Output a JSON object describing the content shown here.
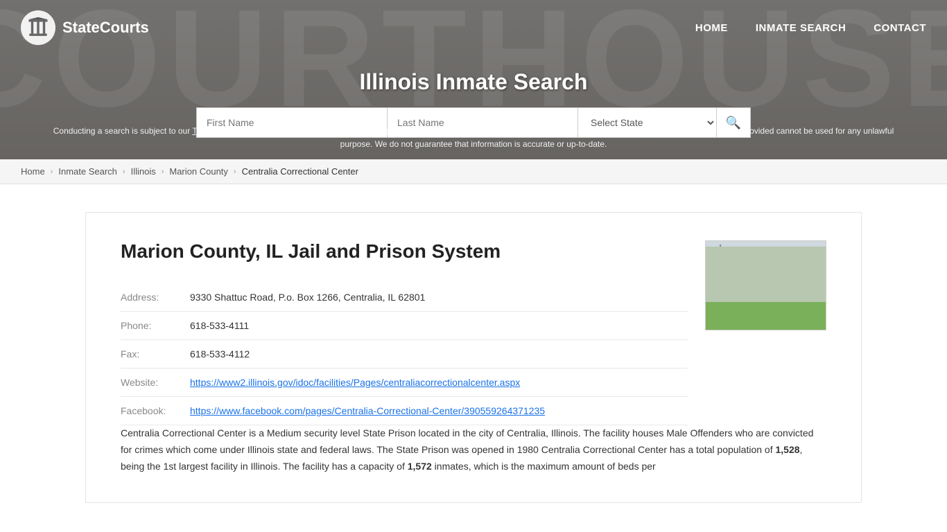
{
  "site": {
    "name": "StateCourts",
    "logo_alt": "StateCourts logo"
  },
  "nav": {
    "home_label": "HOME",
    "inmate_search_label": "INMATE SEARCH",
    "contact_label": "CONTACT"
  },
  "header": {
    "title": "Illinois Inmate Search",
    "search": {
      "first_name_placeholder": "First Name",
      "last_name_placeholder": "Last Name",
      "state_select_default": "Select State",
      "search_icon": "🔍"
    },
    "disclaimer": "Conducting a search is subject to our Terms of Service and Privacy Notice. You acknowledge that StateCourts.org is not a consumer reporting agency under the FCRA and the information provided cannot be used for any unlawful purpose. We do not guarantee that information is accurate or up-to-date."
  },
  "breadcrumb": {
    "items": [
      {
        "label": "Home",
        "href": "#"
      },
      {
        "label": "Inmate Search",
        "href": "#"
      },
      {
        "label": "Illinois",
        "href": "#"
      },
      {
        "label": "Marion County",
        "href": "#"
      },
      {
        "label": "Centralia Correctional Center",
        "href": null
      }
    ]
  },
  "facility": {
    "title": "Marion County, IL Jail and Prison System",
    "address_label": "Address:",
    "address_value": "9330 Shattuc Road, P.o. Box 1266, Centralia, IL 62801",
    "phone_label": "Phone:",
    "phone_value": "618-533-4111",
    "fax_label": "Fax:",
    "fax_value": "618-533-4112",
    "website_label": "Website:",
    "website_url": "https://www2.illinois.gov/idoc/facilities/Pages/centraliacorrectionalcenter.aspx",
    "website_text": "https://www2.illinois.gov/idoc/facilities/Pages/centraliacorrectionalcenter.aspx",
    "facebook_label": "Facebook:",
    "facebook_url": "https://www.facebook.com/pages/Centralia-Correctional-Center/390559264371235",
    "facebook_text": "https://www.facebook.com/pages/Centralia-Correctional-Center/390559264371235",
    "description": "Centralia Correctional Center is a Medium security level State Prison located in the city of Centralia, Illinois. The facility houses Male Offenders who are convicted for crimes which come under Illinois state and federal laws. The State Prison was opened in 1980 Centralia Correctional Center has a total population of 1,528, being the 1st largest facility in Illinois. The facility has a capacity of 1,572 inmates, which is the maximum amount of beds per"
  }
}
